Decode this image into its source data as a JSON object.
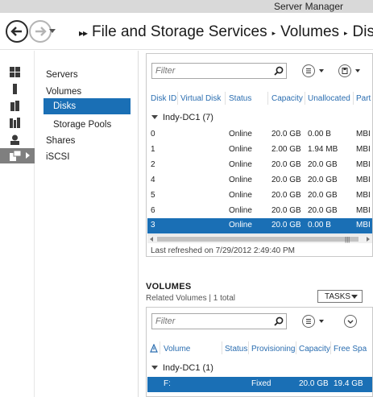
{
  "window": {
    "title": "Server Manager"
  },
  "header": {
    "breadcrumb": [
      "File and Storage Services",
      "Volumes",
      "Disks"
    ]
  },
  "rail": {
    "items": [
      {
        "icon": "dashboard-icon"
      },
      {
        "icon": "local-server-icon"
      },
      {
        "icon": "all-servers-icon"
      },
      {
        "icon": "ad-ds-icon"
      },
      {
        "icon": "iis-icon"
      },
      {
        "icon": "file-storage-services-icon",
        "active": true
      }
    ]
  },
  "subnav": {
    "items": [
      "Servers",
      "Volumes",
      "Disks",
      "Storage Pools",
      "Shares",
      "iSCSI"
    ],
    "selected": "Disks"
  },
  "disks": {
    "filter_placeholder": "Filter",
    "columns": [
      "Disk ID",
      "Virtual Disk",
      "Status",
      "Capacity",
      "Unallocated",
      "Part"
    ],
    "group": "Indy-DC1 (7)",
    "rows": [
      {
        "id": "0",
        "vdisk": "",
        "status": "Online",
        "capacity": "20.0 GB",
        "unalloc": "0.00 B",
        "part": "MBI"
      },
      {
        "id": "1",
        "vdisk": "",
        "status": "Online",
        "capacity": "2.00 GB",
        "unalloc": "1.94 MB",
        "part": "MBI"
      },
      {
        "id": "2",
        "vdisk": "",
        "status": "Online",
        "capacity": "20.0 GB",
        "unalloc": "20.0 GB",
        "part": "MBI"
      },
      {
        "id": "4",
        "vdisk": "",
        "status": "Online",
        "capacity": "20.0 GB",
        "unalloc": "20.0 GB",
        "part": "MBI"
      },
      {
        "id": "5",
        "vdisk": "",
        "status": "Online",
        "capacity": "20.0 GB",
        "unalloc": "20.0 GB",
        "part": "MBI"
      },
      {
        "id": "6",
        "vdisk": "",
        "status": "Online",
        "capacity": "20.0 GB",
        "unalloc": "20.0 GB",
        "part": "MBI"
      },
      {
        "id": "3",
        "vdisk": "",
        "status": "Online",
        "capacity": "20.0 GB",
        "unalloc": "0.00 B",
        "part": "MBI",
        "selected": true
      }
    ],
    "last_refreshed": "Last refreshed on 7/29/2012 2:49:40 PM"
  },
  "volumes": {
    "title": "VOLUMES",
    "subtitle": "Related Volumes | 1 total",
    "tasks_label": "TASKS",
    "filter_placeholder": "Filter",
    "columns": [
      "Volume",
      "Status",
      "Provisioning",
      "Capacity",
      "Free Spa"
    ],
    "group": "Indy-DC1 (1)",
    "rows": [
      {
        "volume": "F:",
        "status": "",
        "provisioning": "Fixed",
        "capacity": "20.0 GB",
        "free": "19.4 GB",
        "selected": true
      }
    ]
  },
  "colors": {
    "accent": "#1a6fb5",
    "header_link": "#2a6db0",
    "rail_active": "#7f7f7f"
  }
}
